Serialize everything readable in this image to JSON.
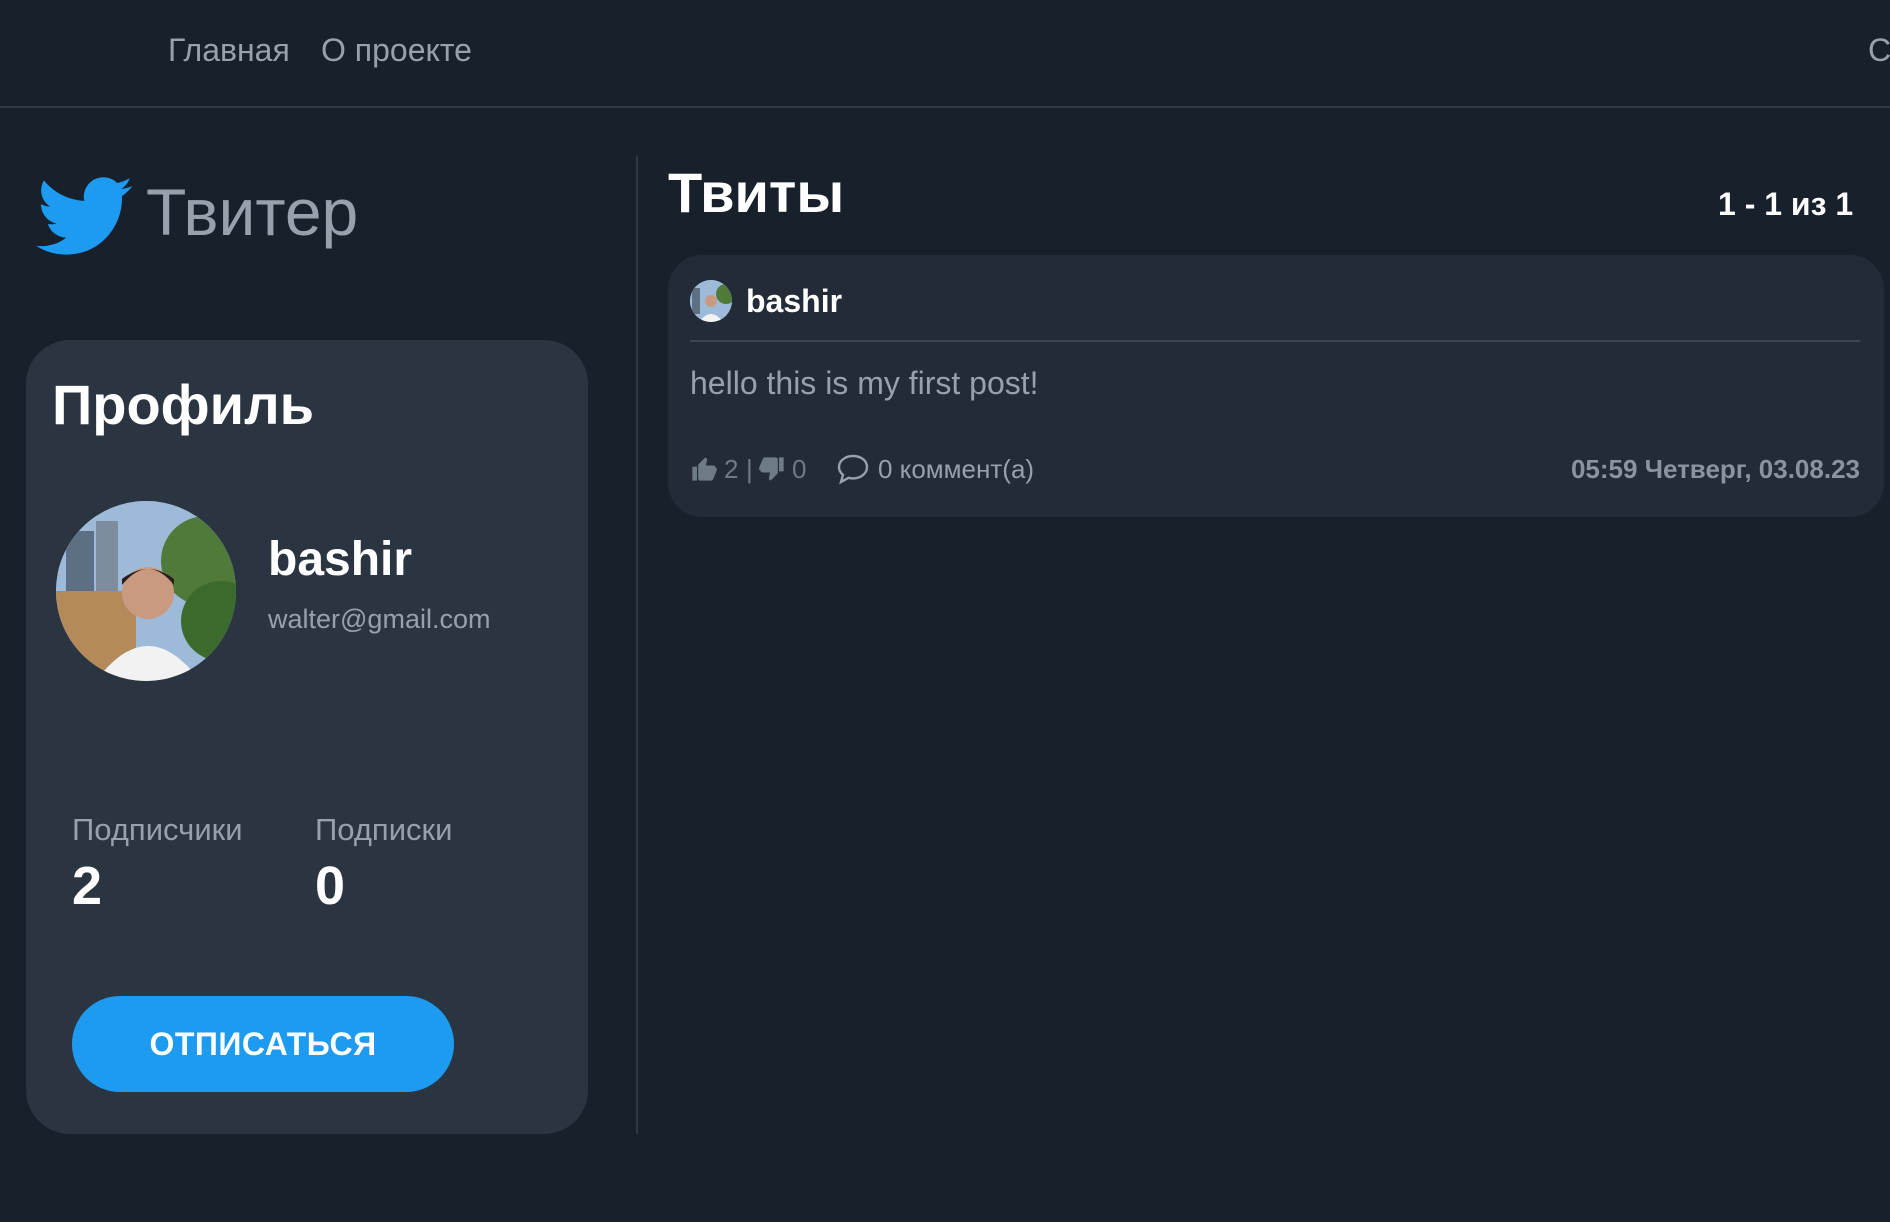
{
  "nav": {
    "items": [
      {
        "label": "Главная"
      },
      {
        "label": "О проекте"
      }
    ],
    "right_glyph": "С"
  },
  "brand": {
    "title": "Твитер",
    "icon": "bird-icon",
    "color": "#1d9bf0"
  },
  "profile": {
    "title": "Профиль",
    "username": "bashir",
    "email": "walter@gmail.com",
    "followers_label": "Подписчики",
    "followers_count": "2",
    "following_label": "Подписки",
    "following_count": "0",
    "unfollow_label": "ОТПИСАТЬСЯ"
  },
  "feed": {
    "title": "Твиты",
    "pagination": "1 - 1 из 1",
    "tweets": [
      {
        "author": "bashir",
        "text": "hello this is my first post!",
        "likes": "2",
        "separator": "|",
        "dislikes": "0",
        "comments": "0 коммент(а)",
        "timestamp": "05:59 Четверг, 03.08.23"
      }
    ]
  },
  "colors": {
    "background": "#18202b",
    "card": "#2b3441",
    "accent": "#1d9bf0",
    "muted_text": "#97a1ad"
  }
}
